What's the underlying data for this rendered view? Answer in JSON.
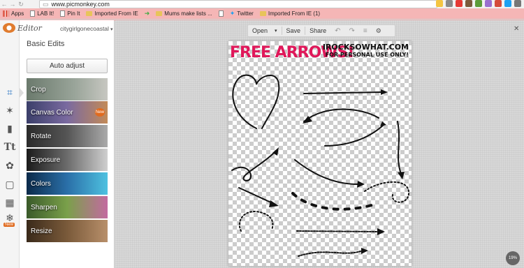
{
  "browser": {
    "url": "www.picmonkey.com",
    "bookmarks": [
      {
        "label": "Apps",
        "icon": "apps-icon"
      },
      {
        "label": "LAB It!",
        "icon": "document-icon"
      },
      {
        "label": "Pin It",
        "icon": "document-icon"
      },
      {
        "label": "Imported From IE",
        "icon": "folder-icon"
      },
      {
        "label": "",
        "icon": "leaf-icon"
      },
      {
        "label": "Mums make lists ...",
        "icon": "folder-icon"
      },
      {
        "label": "",
        "icon": "document-icon"
      },
      {
        "label": "Twitter",
        "icon": "twitter-icon"
      },
      {
        "label": "Imported From IE (1)",
        "icon": "folder-icon"
      }
    ]
  },
  "editor": {
    "logo_text": "Editor",
    "username": "citygirlgonecoastal",
    "section_title": "Basic Edits",
    "auto_adjust": "Auto adjust",
    "tools": [
      {
        "label": "Crop"
      },
      {
        "label": "Canvas Color",
        "badge": "New"
      },
      {
        "label": "Rotate"
      },
      {
        "label": "Exposure"
      },
      {
        "label": "Colors"
      },
      {
        "label": "Sharpen"
      },
      {
        "label": "Resize"
      }
    ],
    "rail_new": "New"
  },
  "toolbar": {
    "open": "Open",
    "save": "Save",
    "share": "Share"
  },
  "canvas": {
    "title": "FREE ARROWS!",
    "site": "IROCKSOWHAT.COM",
    "note": "FOR PERSONAL USE ONLY!"
  },
  "zoom": "19%",
  "colors": {
    "accent_pink": "#e0185a",
    "orange": "#e06b1f",
    "active_blue": "#2a75c4"
  }
}
